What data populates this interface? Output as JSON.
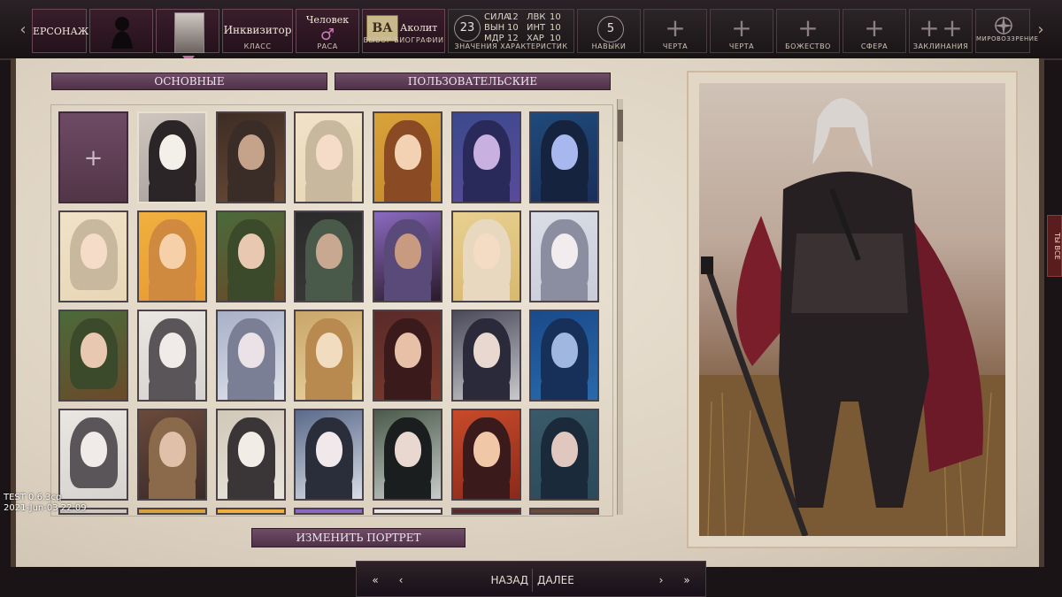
{
  "topbar": {
    "tab_character": "ЕРСОНАЖ",
    "class": {
      "value": "Инквизитор",
      "caption": "КЛАСС"
    },
    "race": {
      "value": "Человек",
      "caption": "РАСА"
    },
    "background": {
      "logo": "ВА",
      "value": "Аколит",
      "caption": "ВЫБОР БИОГРАФИИ"
    },
    "stats": {
      "total": "23",
      "caption": "ЗНАЧЕНИЯ ХАРАКТЕРИСТИК",
      "rows": [
        {
          "a_name": "СИЛА",
          "a_val": "12",
          "b_name": "ЛВК",
          "b_val": "10"
        },
        {
          "a_name": "ВЫН",
          "a_val": "10",
          "b_name": "ИНТ",
          "b_val": "10"
        },
        {
          "a_name": "МДР",
          "a_val": "12",
          "b_name": "ХАР",
          "b_val": "10"
        }
      ]
    },
    "skills": {
      "count": "5",
      "caption": "НАВЫКИ"
    },
    "feat1": {
      "caption": "ЧЕРТА"
    },
    "feat2": {
      "caption": "ЧЕРТА"
    },
    "deity": {
      "caption": "БОЖЕСТВО"
    },
    "sphere": {
      "caption": "СФЕРА"
    },
    "spells": {
      "caption": "ЗАКЛИНАНИЯ"
    },
    "alignment": {
      "caption": "МИРОВОЗЗРЕНИЕ"
    }
  },
  "tabs": {
    "basic": "ОСНОВНЫЕ",
    "custom": "ПОЛЬЗОВАТЕЛЬСКИЕ"
  },
  "change_portrait": "ИЗМЕНИТЬ ПОРТРЕТ",
  "side_tab": "ТЫ ВСЕ",
  "version": {
    "build": "TEST 0.6.3cq",
    "date": "2021-Jun-03 22:09"
  },
  "bottom_nav": {
    "back": "НАЗАД",
    "next": "ДАЛЕЕ"
  },
  "colors": {
    "accent": "#6f4d66",
    "parchment": "#e4dbcc",
    "frame": "#2a2226"
  }
}
